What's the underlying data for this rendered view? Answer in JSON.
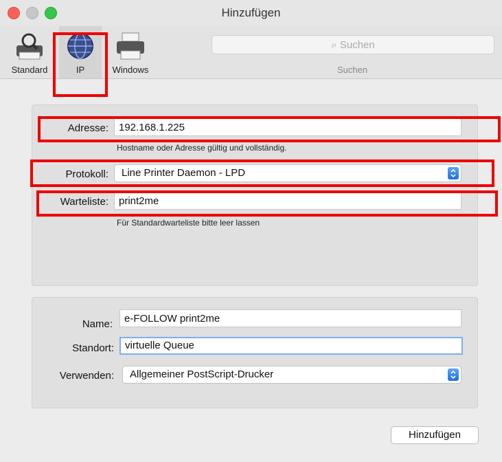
{
  "window": {
    "title": "Hinzufügen"
  },
  "toolbar": {
    "tabs": [
      {
        "label": "Standard",
        "icon": "printer-search-icon"
      },
      {
        "label": "IP",
        "icon": "globe-icon"
      },
      {
        "label": "Windows",
        "icon": "printer-icon"
      }
    ],
    "search": {
      "placeholder": "Suchen",
      "caption": "Suchen"
    }
  },
  "ip_form": {
    "address": {
      "label": "Adresse:",
      "value": "192.168.1.225",
      "hint": "Hostname oder Adresse gültig und vollständig."
    },
    "protocol": {
      "label": "Protokoll:",
      "value": "Line Printer Daemon - LPD"
    },
    "queue": {
      "label": "Warteliste:",
      "value": "print2me",
      "hint": "Für Standardwarteliste bitte leer lassen"
    }
  },
  "printer_form": {
    "name": {
      "label": "Name:",
      "value": "e-FOLLOW print2me"
    },
    "location": {
      "label": "Standort:",
      "value": "virtuelle Queue"
    },
    "use": {
      "label": "Verwenden:",
      "value": "Allgemeiner PostScript-Drucker"
    }
  },
  "footer": {
    "add_label": "Hinzufügen"
  },
  "colors": {
    "highlight": "#ee0000",
    "accent": "#1f6fe0"
  }
}
